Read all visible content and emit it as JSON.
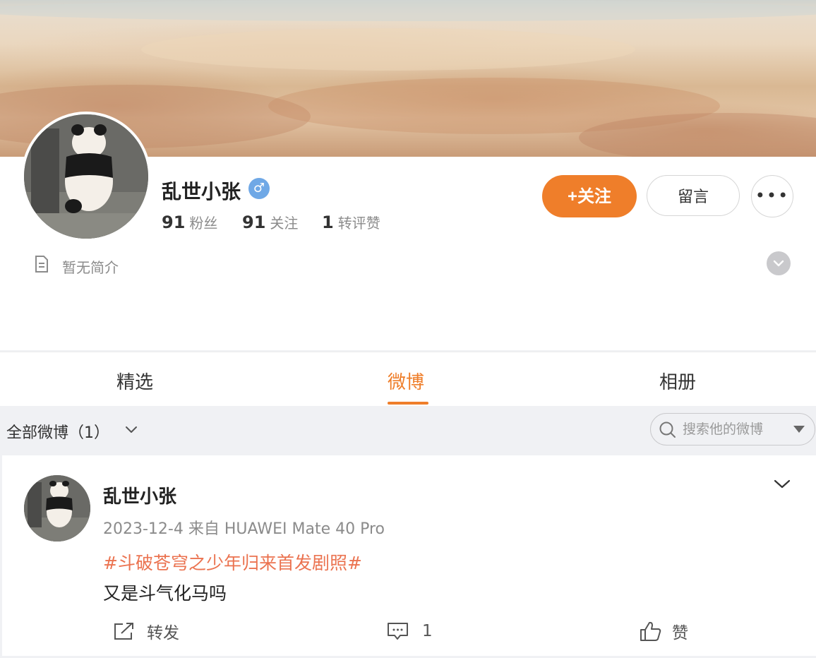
{
  "profile": {
    "name": "乱世小张",
    "gender_symbol": "♂",
    "stats": [
      {
        "value": "91",
        "label": "粉丝"
      },
      {
        "value": "91",
        "label": "关注"
      },
      {
        "value": "1",
        "label": "转评赞"
      }
    ],
    "follow_label": "+关注",
    "message_label": "留言",
    "more_label": "•••",
    "bio": "暂无简介"
  },
  "tabs": [
    {
      "label": "精选",
      "active": false
    },
    {
      "label": "微博",
      "active": true
    },
    {
      "label": "相册",
      "active": false
    }
  ],
  "filter": {
    "label": "全部微博（1）",
    "search_placeholder": "搜索他的微博"
  },
  "post": {
    "author": "乱世小张",
    "date": "2023-12-4",
    "source": "来自 HUAWEI Mate 40 Pro",
    "topic": "#斗破苍穹之少年归来首发剧照#",
    "text": "又是斗气化马吗",
    "repost_label": "转发",
    "comment_count": "1",
    "like_label": "赞"
  },
  "colors": {
    "accent": "#ef7e2a",
    "topic": "#eb7350",
    "gender_badge": "#6fa8e6",
    "page_bg": "#f0f1f4"
  }
}
